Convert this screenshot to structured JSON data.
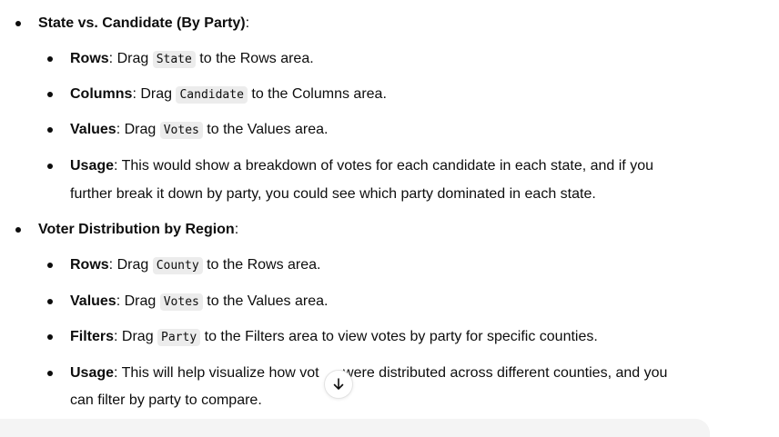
{
  "sections": [
    {
      "title": "State vs. Candidate (By Party)",
      "title_suffix": ":",
      "items": [
        {
          "label": "Rows",
          "pre": ": Drag ",
          "code": "State",
          "post": " to the Rows area."
        },
        {
          "label": "Columns",
          "pre": ": Drag ",
          "code": "Candidate",
          "post": " to the Columns area."
        },
        {
          "label": "Values",
          "pre": ": Drag ",
          "code": "Votes",
          "post": " to the Values area."
        },
        {
          "label": "Usage",
          "text_line1": ": This would show a breakdown of votes for each candidate in each state, and if you",
          "text_line2": "further break it down by party, you could see which party dominated in each state."
        }
      ]
    },
    {
      "title": "Voter Distribution by Region",
      "title_suffix": ":",
      "items": [
        {
          "label": "Rows",
          "pre": ": Drag ",
          "code": "County",
          "post": " to the Rows area."
        },
        {
          "label": "Values",
          "pre": ": Drag ",
          "code": "Votes",
          "post": " to the Values area."
        },
        {
          "label": "Filters",
          "pre": ": Drag ",
          "code": "Party",
          "post": " to the Filters area to view votes by party for specific counties."
        },
        {
          "label": "Usage",
          "text_line1": ": This will help visualize how vot",
          "text_line1b": " were distributed across different counties, and you",
          "text_line2": "can filter by party to compare."
        }
      ]
    }
  ],
  "scroll_button": {
    "icon": "arrow-down-icon"
  }
}
